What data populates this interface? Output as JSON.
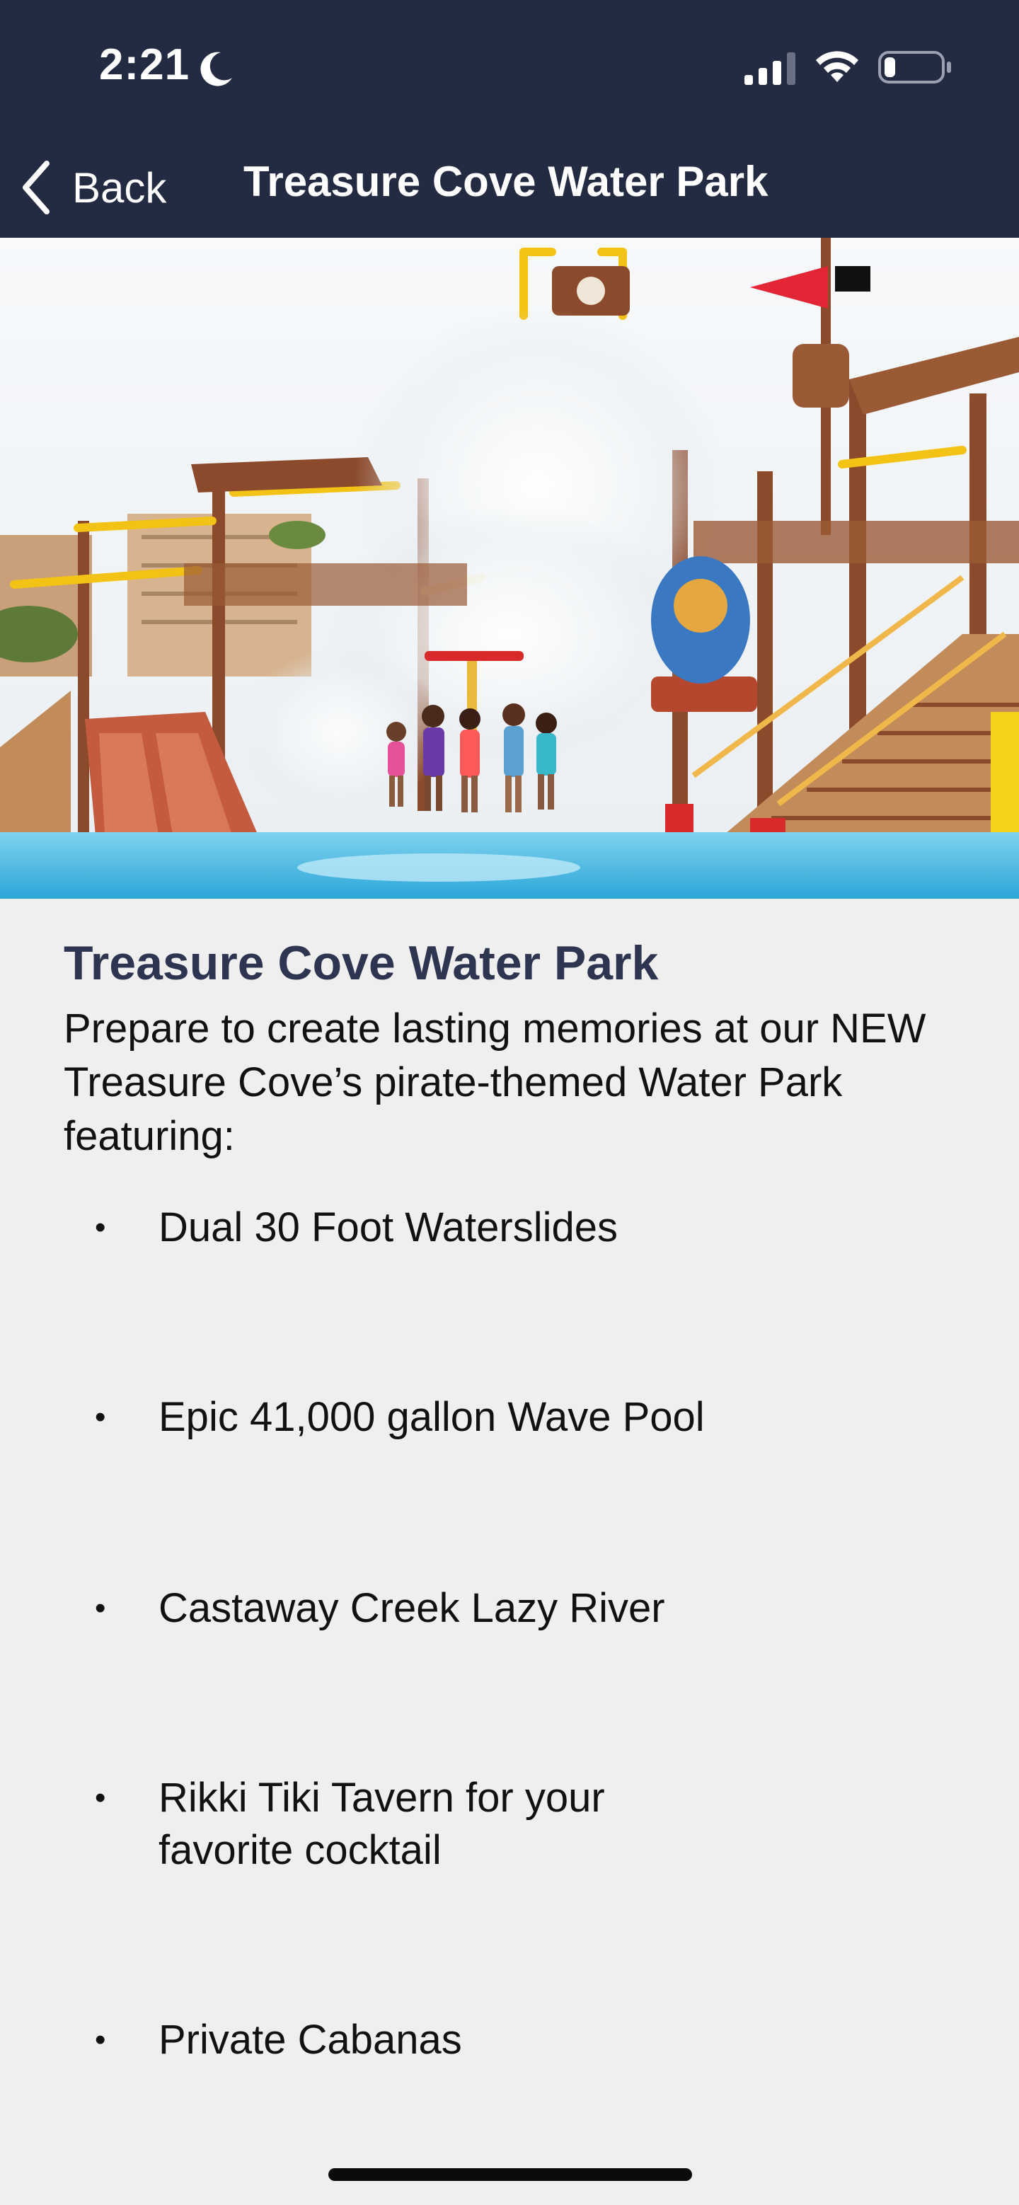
{
  "status_bar": {
    "time": "2:21",
    "moon_icon": "moon-icon",
    "signal_icon": "cellular-signal-icon",
    "wifi_icon": "wifi-icon",
    "battery_icon": "battery-icon",
    "battery_level": 0.2
  },
  "nav": {
    "back_label": "Back",
    "back_icon": "chevron-left-icon",
    "title": "Treasure Cove Water Park"
  },
  "content": {
    "title": "Treasure Cove Water Park",
    "intro": "Prepare to create lasting memories at our NEW Treasure Cove’s pirate-themed Water Park featuring:",
    "features": [
      "Dual 30 Foot Waterslides",
      "Epic 41,000 gallon Wave Pool",
      "Castaway Creek Lazy River",
      "Rikki Tiki Tavern for your favorite cocktail",
      "Private Cabanas"
    ]
  },
  "colors": {
    "header_bg": "#232b43",
    "page_bg": "#efefef",
    "title_color": "#2d3550"
  }
}
